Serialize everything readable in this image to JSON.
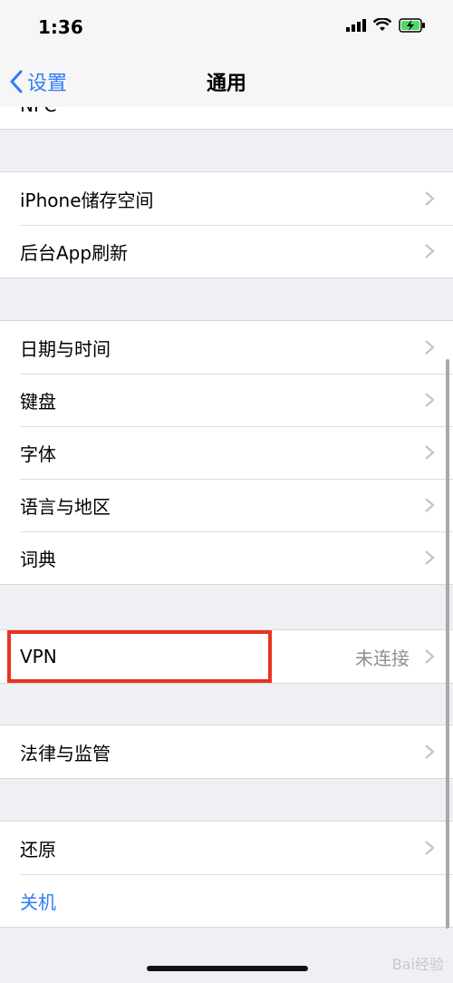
{
  "status": {
    "time": "1:36"
  },
  "nav": {
    "back_label": "设置",
    "title": "通用"
  },
  "truncated_label": "NFC",
  "groups": {
    "g1": [
      {
        "label": "iPhone储存空间"
      },
      {
        "label": "后台App刷新"
      }
    ],
    "g2": [
      {
        "label": "日期与时间"
      },
      {
        "label": "键盘"
      },
      {
        "label": "字体"
      },
      {
        "label": "语言与地区"
      },
      {
        "label": "词典"
      }
    ],
    "g3": [
      {
        "label": "VPN",
        "value": "未连接"
      }
    ],
    "g4": [
      {
        "label": "法律与监管"
      }
    ],
    "g5": [
      {
        "label": "还原"
      },
      {
        "label": "关机"
      }
    ]
  },
  "watermark": "Bai经验",
  "colors": {
    "accent": "#2f7df6",
    "highlight": "#ea3323",
    "battery": "#4cd964"
  },
  "icons": {
    "signal": "signal-icon",
    "wifi": "wifi-icon",
    "battery": "battery-charging-icon",
    "chevron": "chevron-right-icon",
    "back": "chevron-left-icon"
  }
}
